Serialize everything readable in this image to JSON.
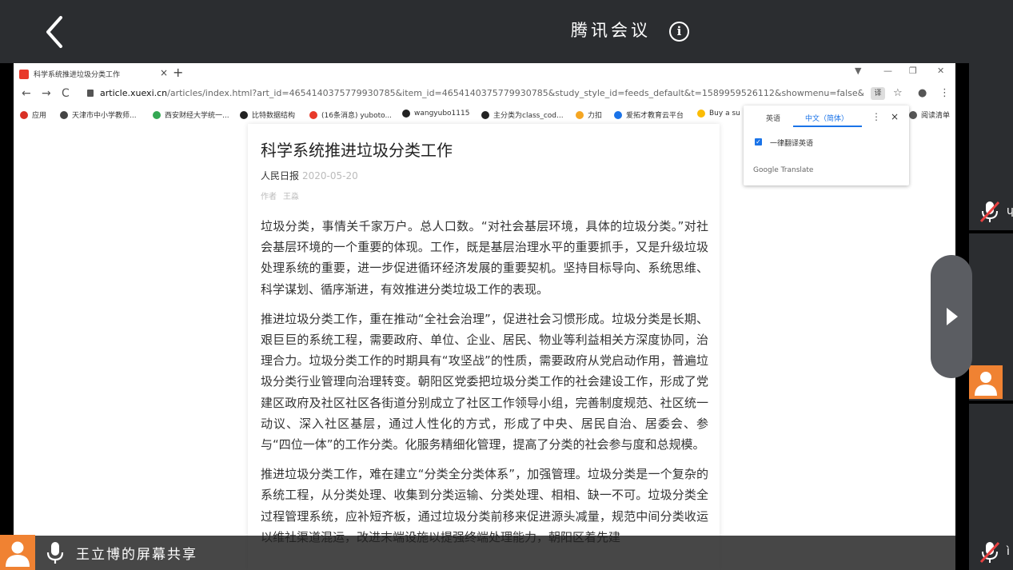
{
  "meeting": {
    "app_title": "腾讯会议",
    "info_glyph": "i",
    "share_status": "王立博的屏幕共享"
  },
  "browser": {
    "tab_title": "科学系统推进垃圾分类工作",
    "tab_close": "×",
    "new_tab": "+",
    "nav": {
      "back": "←",
      "forward": "→",
      "reload": "C"
    },
    "url_domain": "article.xuexi.cn",
    "url_path": "/articles/index.html?art_id=4654140375779930785&item_id=4654140375779930785&study_style_id=feeds_default&t=1589959526112&showmenu=false&ref_read_id=...",
    "translate_badge": "译",
    "star": "☆",
    "more": "⋮",
    "bookmarks": [
      {
        "label": "应用",
        "color": "#d93025"
      },
      {
        "label": "天津市中小学教师...",
        "color": "#444"
      },
      {
        "label": "西安财经大学统一...",
        "color": "#34a853"
      },
      {
        "label": "比特数据结构",
        "color": "#222"
      },
      {
        "label": "(16条消息) yuboto...",
        "color": "#e8392a"
      },
      {
        "label": "wangyubo1115",
        "color": "#222"
      },
      {
        "label": "主分类为class_cod...",
        "color": "#222"
      },
      {
        "label": "力扣",
        "color": "#f5a623"
      },
      {
        "label": "爱拓才教育云平台",
        "color": "#1a73e8"
      },
      {
        "label": "Buy a su",
        "color": "#fbbc05"
      },
      {
        "label": "阅读清单",
        "color": "#555"
      }
    ]
  },
  "translate_popup": {
    "tab_source": "英语",
    "tab_target": "中文（简体）",
    "menu": "⋮",
    "close": "×",
    "checkbox_label": "一律翻译英语",
    "brand": "Google Translate"
  },
  "article": {
    "title": "科学系统推进垃圾分类工作",
    "source": "人民日报",
    "date": "2020-05-20",
    "author_label": "作者",
    "author_name": "王淼",
    "paragraphs": [
      "垃圾分类，事情关千家万户。总人口数。“对社会基层环境，具体的垃圾分类。”对社会基层环境的一个重要的体现。工作，既是基层治理水平的重要抓手，又是升级垃圾处理系统的重要，进一步促进循环经济发展的重要契机。坚持目标导向、系统思维、科学谋划、循序渐进，有效推进分类垃圾工作的表现。",
      "推进垃圾分类工作，重在推动“全社会治理”，促进社会习惯形成。垃圾分类是长期、艰巨巨的系统工程，需要政府、单位、企业、居民、物业等利益相关方深度协同，治理合力。垃圾分类工作的时期具有“攻坚战”的性质，需要政府从党启动作用，普遍垃圾分类行业管理向治理转变。朝阳区党委把垃圾分类工作的社会建设工作，形成了党建区政府及社区社区各街道分别成立了社区工作领导小组，完善制度规范、社区统一动议、深入社区基层，通过人性化的方式，形成了中央、居民自治、居委会、参与“四位一体”的工作分类。化服务精细化管理，提高了分类的社会参与度和总规模。",
      "推进垃圾分类工作，难在建立“分类全分类体系”，加强管理。垃圾分类是一个复杂的系统工程，从分类处理、收集到分类运输、分类处理、相相、缺一不可。垃圾分类全过程管理系统，应补短齐板，通过垃圾分类前移来促进源头减量，规范中间分类收运以维社渠道混运，改进末端设施以提强终端处理能力，朝阳区着先建"
    ]
  }
}
